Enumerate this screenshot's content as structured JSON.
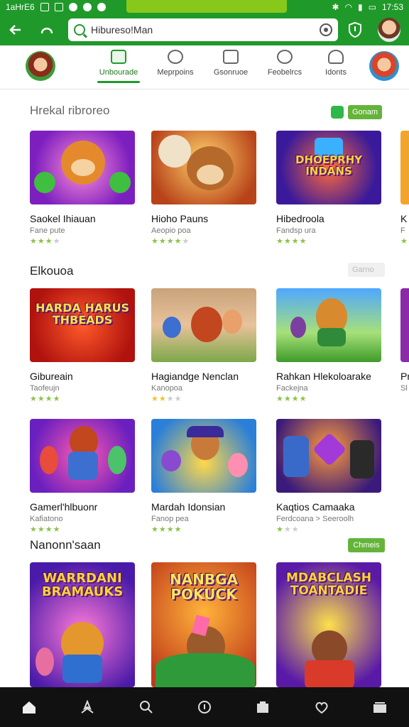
{
  "status": {
    "left_text": "1aHrE6",
    "time": "17:53"
  },
  "search": {
    "value": "Hibureso!Man"
  },
  "tabs": [
    {
      "label": "Unbourade",
      "active": true
    },
    {
      "label": "Meprpoins"
    },
    {
      "label": "Gsonruoe"
    },
    {
      "label": "Feobelrcs"
    },
    {
      "label": "Idonts"
    }
  ],
  "sections": [
    {
      "title": "Hrekal ribroreo",
      "button": "Gonam",
      "cards": [
        {
          "name": "Saokel Ihiauan",
          "sub": "Fane pute",
          "stars": 3
        },
        {
          "name": "Hioho Pauns",
          "sub": "Aeopio poa",
          "stars": 4
        },
        {
          "name": "Hibedroola",
          "sub": "Fandsp ura",
          "stars": 4
        },
        {
          "name": "K",
          "sub": "F",
          "stars": 1
        }
      ],
      "thumb_labels": [
        "",
        "",
        "DHOEPRHY INDANS",
        ""
      ]
    },
    {
      "title": "Elkouoa",
      "button": "Garno",
      "cards": [
        {
          "name": "Gibureain",
          "sub": "Taofeujn",
          "stars": 4
        },
        {
          "name": "Hagiandge Nenclan",
          "sub": "Kanopoa",
          "stars": 2
        },
        {
          "name": "Rahkan Hlekoloarake",
          "sub": "Fackejna",
          "stars": 4
        },
        {
          "name": "Pr",
          "sub": "Sl",
          "stars": 1
        }
      ],
      "thumb_labels": [
        "HARDA HARUS THBEADS",
        "",
        "",
        ""
      ]
    },
    {
      "cards": [
        {
          "name": "Gamerl'hlbuonr",
          "sub": "Kafiatono",
          "stars": 4
        },
        {
          "name": "Mardah Idonsian",
          "sub": "Fanop pea",
          "stars": 4
        },
        {
          "name": "Kaqtios Camaaka",
          "sub": "Ferdcoana > Seeroolh",
          "stars": 1
        }
      ]
    },
    {
      "title": "Nanonn'saan",
      "button": "Chmeis",
      "thumb_labels": [
        "WARRDANI BRAMAUKS",
        "NANBGA POKUCK",
        "MDABCLASH TOANTADIE"
      ]
    }
  ],
  "bottom_nav": [
    "home-icon",
    "apps-icon",
    "search-icon",
    "download-icon",
    "library-icon",
    "heart-icon",
    "tabs-icon"
  ],
  "colors": {
    "brand": "#1f9a2a",
    "star": "#8bc34a"
  }
}
